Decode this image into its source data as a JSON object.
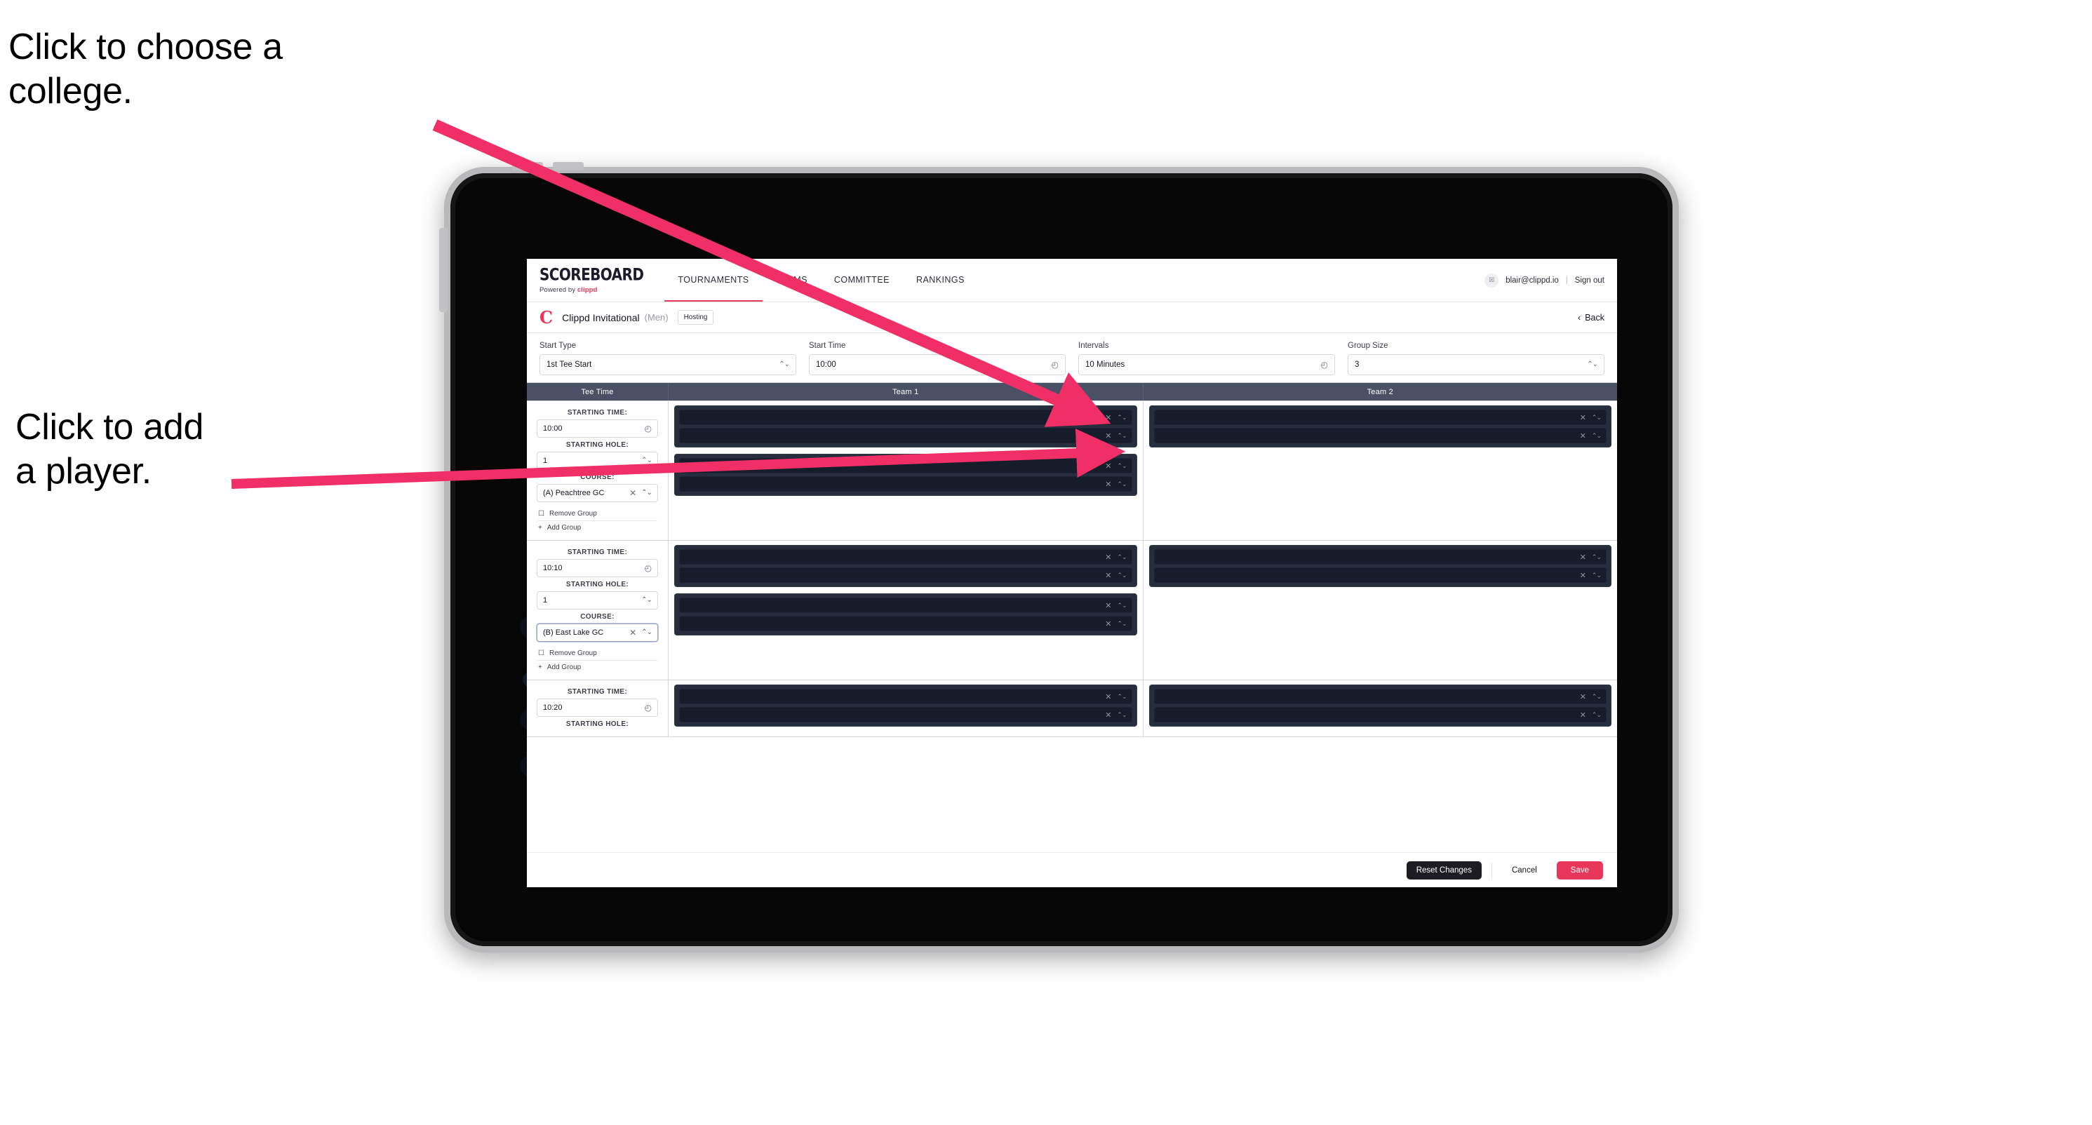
{
  "annotations": {
    "college": "Click to choose a\ncollege.",
    "player": "Click to add\na player."
  },
  "colors": {
    "accent_pink": "#e8375a",
    "table_header": "#4a5066",
    "player_card": "#262e3e",
    "player_row": "#151c2a",
    "dark_button": "#1c1c22"
  },
  "topnav": {
    "brand_main": "SCOREBOARD",
    "brand_sub_prefix": "Powered by ",
    "brand_sub_accent": "clippd",
    "links": [
      {
        "label": "TOURNAMENTS",
        "active": true
      },
      {
        "label": "TEAMS",
        "active": false
      },
      {
        "label": "COMMITTEE",
        "active": false
      },
      {
        "label": "RANKINGS",
        "active": false
      }
    ],
    "avatar_glyph": "☒",
    "user_email": "blair@clippd.io",
    "separator": "|",
    "sign_out": "Sign out"
  },
  "titlebar": {
    "logo_letter": "C",
    "tournament_name": "Clippd Invitational",
    "gender": "(Men)",
    "badge": "Hosting",
    "back_chevron": "‹",
    "back_label": "Back"
  },
  "settings": {
    "fields": [
      {
        "label": "Start Type",
        "value": "1st Tee Start",
        "icon": "stepper-icon",
        "glyph": "⌃⌄"
      },
      {
        "label": "Start Time",
        "value": "10:00",
        "icon": "clock-icon",
        "glyph": "◴"
      },
      {
        "label": "Intervals",
        "value": "10 Minutes",
        "icon": "clock-icon",
        "glyph": "◴"
      },
      {
        "label": "Group Size",
        "value": "3",
        "icon": "stepper-icon",
        "glyph": "⌃⌄"
      }
    ]
  },
  "table": {
    "headers": [
      "Tee Time",
      "Team 1",
      "Team 2"
    ],
    "labels": {
      "starting_time": "STARTING TIME:",
      "starting_hole": "STARTING HOLE:",
      "course": "COURSE:",
      "remove_group": "Remove Group",
      "add_group": "Add Group",
      "trash_glyph": "☐",
      "plus_glyph": "+",
      "clock_glyph": "◴",
      "stepper_glyph": "⌃⌄",
      "clear_glyph": "✕"
    },
    "groups": [
      {
        "starting_time": "10:00",
        "starting_hole": "1",
        "course": "(A) Peachtree GC",
        "course_focused": false,
        "team1": [
          {
            "players": [
              "",
              ""
            ]
          },
          {
            "players": [
              "",
              ""
            ]
          }
        ],
        "team2": [
          {
            "players": [
              "",
              ""
            ]
          }
        ]
      },
      {
        "starting_time": "10:10",
        "starting_hole": "1",
        "course": "(B) East Lake GC",
        "course_focused": true,
        "team1": [
          {
            "players": [
              "",
              ""
            ]
          },
          {
            "players": [
              "",
              ""
            ]
          }
        ],
        "team2": [
          {
            "players": [
              "",
              ""
            ]
          }
        ]
      },
      {
        "starting_time": "10:20",
        "starting_hole": "",
        "course": "",
        "course_focused": false,
        "team1": [
          {
            "players": [
              "",
              ""
            ]
          }
        ],
        "team2": [
          {
            "players": [
              "",
              ""
            ]
          }
        ]
      }
    ]
  },
  "footer": {
    "reset": "Reset Changes",
    "cancel": "Cancel",
    "save": "Save"
  }
}
